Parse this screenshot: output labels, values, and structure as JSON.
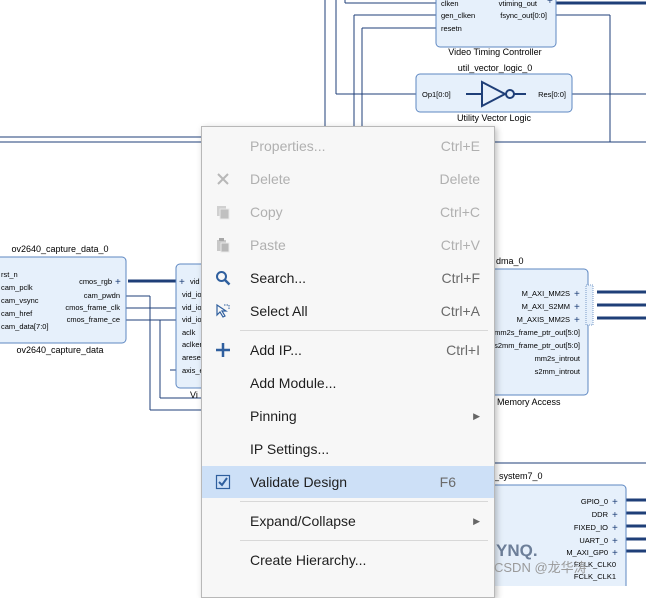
{
  "diagram": {
    "vtc": {
      "title": "Video Timing Controller",
      "ports_left": [
        "clken",
        "gen_clken",
        "resetn"
      ],
      "ports_right": [
        "vtiming_out",
        "fsync_out[0:0]"
      ]
    },
    "uvl": {
      "name": "util_vector_logic_0",
      "title": "Utility Vector Logic",
      "port_in": "Op1[0:0]",
      "port_out": "Res[0:0]"
    },
    "ov": {
      "name": "ov2640_capture_data_0",
      "title": "ov2640_capture_data",
      "ports_left": [
        "rst_n",
        "cam_pclk",
        "cam_vsync",
        "cam_href",
        "cam_data[7:0]"
      ],
      "ports_right": [
        "cmos_rgb",
        "cam_pwdn",
        "cmos_frame_clk",
        "cmos_frame_ce"
      ]
    },
    "vid": {
      "ports": [
        "vid",
        "vid_io",
        "vid_io",
        "vid_io",
        "aclk",
        "aclken",
        "aresetn",
        "axis_e"
      ],
      "title": "Vi"
    },
    "vdma": {
      "name": "dma_0",
      "title": "Memory Access",
      "ports_right": [
        "M_AXI_MM2S",
        "M_AXI_S2MM",
        "M_AXIS_MM2S",
        "mm2s_frame_ptr_out[5:0]",
        "s2mm_frame_ptr_out[5:0]",
        "mm2s_introut",
        "s2mm_introut"
      ]
    },
    "ps": {
      "name": "_system7_0",
      "ports_right": [
        "GPIO_0",
        "DDR",
        "FIXED_IO",
        "UART_0",
        "M_AXI_GP0",
        "FCLK_CLK0",
        "FCLK_CLK1"
      ],
      "logo": "YNQ."
    }
  },
  "context_menu": {
    "items": [
      {
        "id": "properties",
        "label": "Properties...",
        "shortcut": "Ctrl+E",
        "icon": "none",
        "disabled": true
      },
      {
        "id": "delete",
        "label": "Delete",
        "shortcut": "Delete",
        "icon": "close-icon",
        "disabled": true
      },
      {
        "id": "copy",
        "label": "Copy",
        "shortcut": "Ctrl+C",
        "icon": "copy-icon",
        "disabled": true
      },
      {
        "id": "paste",
        "label": "Paste",
        "shortcut": "Ctrl+V",
        "icon": "paste-icon",
        "disabled": true
      },
      {
        "id": "search",
        "label": "Search...",
        "shortcut": "Ctrl+F",
        "icon": "search-icon",
        "disabled": false
      },
      {
        "id": "select-all",
        "label": "Select All",
        "shortcut": "Ctrl+A",
        "icon": "select-all-icon",
        "disabled": false
      },
      {
        "id": "add-ip",
        "label": "Add IP...",
        "shortcut": "Ctrl+I",
        "icon": "plus-icon",
        "disabled": false
      },
      {
        "id": "add-module",
        "label": "Add Module...",
        "shortcut": "",
        "icon": "none",
        "disabled": false
      },
      {
        "id": "pinning",
        "label": "Pinning",
        "shortcut": "",
        "icon": "none",
        "disabled": false,
        "submenu": true
      },
      {
        "id": "ip-settings",
        "label": "IP Settings...",
        "shortcut": "",
        "icon": "none",
        "disabled": false
      },
      {
        "id": "validate-design",
        "label": "Validate Design",
        "shortcut": "F6",
        "icon": "check-icon",
        "disabled": false,
        "highlighted": true
      },
      {
        "id": "expand-collapse",
        "label": "Expand/Collapse",
        "shortcut": "",
        "icon": "none",
        "disabled": false,
        "submenu": true
      },
      {
        "id": "create-hierarchy",
        "label": "Create Hierarchy...",
        "shortcut": "",
        "icon": "none",
        "disabled": false
      }
    ]
  },
  "watermark": "CSDN @龙华涛",
  "colors": {
    "block_fill": "#e6f0fb",
    "block_border": "#5d87c2",
    "wire": "#1f3f78",
    "highlight": "#cde0f7",
    "accent": "#3b6fb0"
  }
}
